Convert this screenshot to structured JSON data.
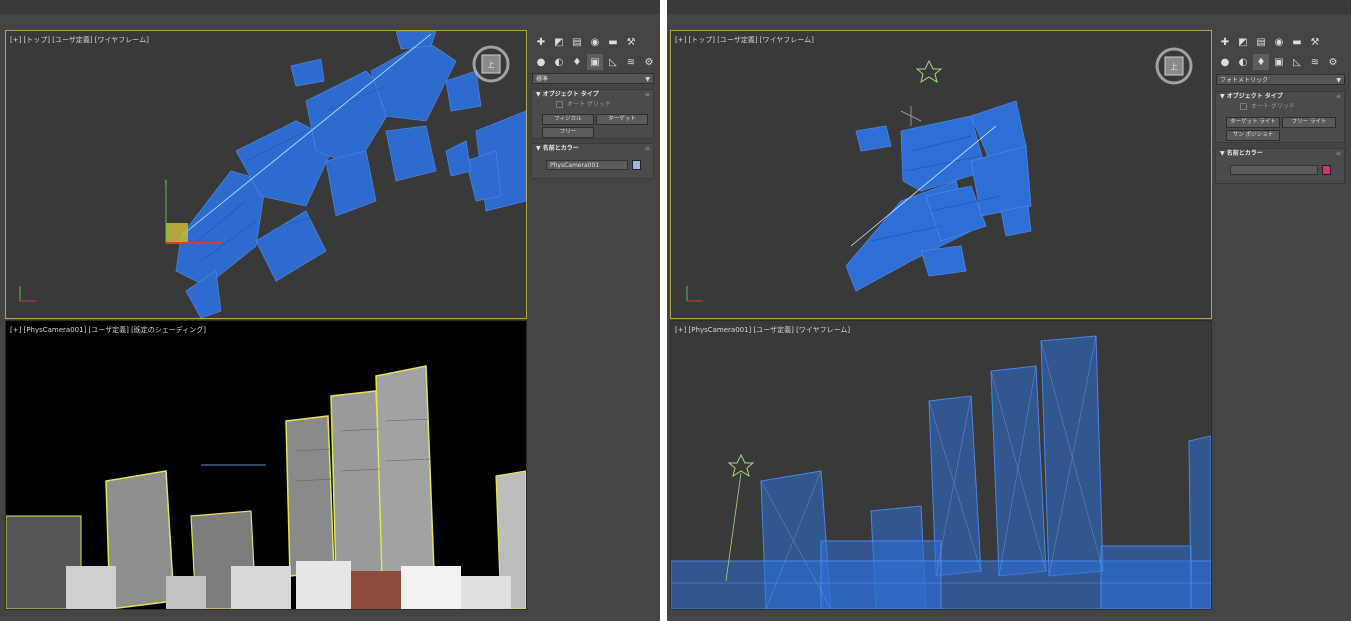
{
  "left": {
    "top_viewport": {
      "label": "[+] [トップ] [ユーザ定義] [ワイヤフレーム]"
    },
    "camera_viewport": {
      "label": "[+] [PhysCamera001] [ユーザ定義] [既定のシェーディング]"
    },
    "viewcube": {
      "face_label": "上"
    },
    "command_panel": {
      "category_dropdown": "標準",
      "object_type": {
        "title": "オブジェクト タイプ",
        "autogrid_label": "オート グリッド",
        "buttons": [
          "フィジカル",
          "ターゲット",
          "フリー"
        ]
      },
      "name_color": {
        "title": "名前とカラー",
        "name_value": "PhysCamera001",
        "swatch_color": "#9fb4e6"
      }
    }
  },
  "right": {
    "top_viewport": {
      "label": "[+] [トップ] [ユーザ定義] [ワイヤフレーム]"
    },
    "camera_viewport": {
      "label": "[+] [PhysCamera001] [ユーザ定義] [ワイヤフレーム]"
    },
    "viewcube": {
      "face_label": "上"
    },
    "command_panel": {
      "category_dropdown": "フォトメトリック",
      "object_type": {
        "title": "オブジェクト タイプ",
        "autogrid_label": "オート グリッド",
        "buttons": [
          "ターゲット ライト",
          "フリー ライト",
          "サン ポジショナ"
        ]
      },
      "name_color": {
        "title": "名前とカラー",
        "name_value": "",
        "swatch_color": "#d62b7e"
      }
    }
  },
  "icons": [
    "create-icon",
    "modify-icon",
    "hierarchy-icon",
    "motion-icon",
    "display-icon",
    "utilities-icon"
  ],
  "colors": {
    "wire_blue": "#2d6fd6",
    "active_border": "#b7a34a",
    "viewport_bg": "#393939"
  }
}
